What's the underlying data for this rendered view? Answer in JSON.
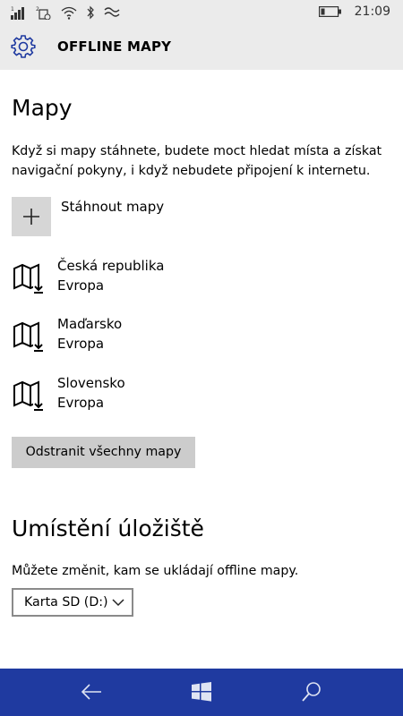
{
  "status_bar": {
    "time": "21:09"
  },
  "header": {
    "title": "OFFLINE MAPY"
  },
  "maps_section": {
    "title": "Mapy",
    "description": "Když si mapy stáhnete, budete moct hledat místa a získat navigační pokyny, i když nebudete připojení k internetu.",
    "download_label": "Stáhnout mapy",
    "items": [
      {
        "name": "Česká republika",
        "region": "Evropa"
      },
      {
        "name": "Maďarsko",
        "region": "Evropa"
      },
      {
        "name": "Slovensko",
        "region": "Evropa"
      }
    ],
    "remove_all_label": "Odstranit všechny mapy"
  },
  "storage_section": {
    "title": "Umístění úložiště",
    "description": "Můžete změnit, kam se ukládají offline mapy.",
    "selected": "Karta SD (D:)"
  },
  "colors": {
    "nav_bar": "#1f3aa0",
    "accent": "#1f3aa0",
    "header_bg": "#ebebeb"
  },
  "icons": {
    "settings": "gear-icon",
    "add": "plus-icon",
    "map": "map-download-icon",
    "back": "back-arrow-icon",
    "home": "windows-logo-icon",
    "search": "search-icon"
  }
}
